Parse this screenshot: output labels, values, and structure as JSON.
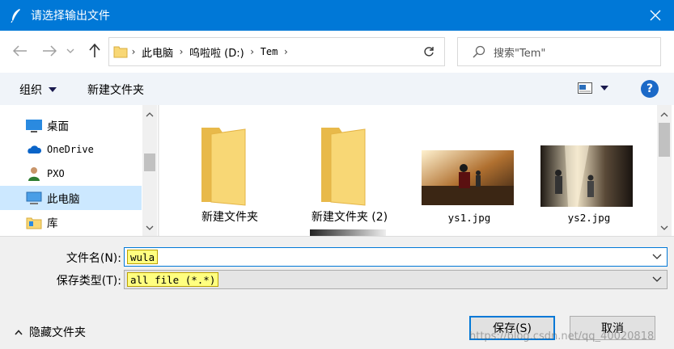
{
  "window": {
    "title": "请选择输出文件"
  },
  "address": {
    "crumbs": [
      "此电脑",
      "呜啦啦 (D:)",
      "Tem"
    ],
    "search_placeholder": "搜索\"Tem\""
  },
  "toolbar": {
    "organize": "组织",
    "new_folder": "新建文件夹"
  },
  "nav": {
    "items": [
      {
        "label": "桌面",
        "icon": "desktop-icon"
      },
      {
        "label": "OneDrive",
        "icon": "cloud-icon"
      },
      {
        "label": "PXO",
        "icon": "user-icon"
      },
      {
        "label": "此电脑",
        "icon": "computer-icon",
        "selected": true
      },
      {
        "label": "库",
        "icon": "library-icon"
      }
    ]
  },
  "files": [
    {
      "name": "新建文件夹",
      "type": "folder"
    },
    {
      "name": "新建文件夹 (2)",
      "type": "folder"
    },
    {
      "name": "ys1.jpg",
      "type": "image"
    },
    {
      "name": "ys2.jpg",
      "type": "image"
    }
  ],
  "form": {
    "filename_label": "文件名(N):",
    "filename_value": "wula",
    "filetype_label": "保存类型(T):",
    "filetype_value": "all file (*.*)"
  },
  "footer": {
    "hide_folders": "隐藏文件夹",
    "save": "保存(S)",
    "cancel": "取消",
    "watermark": "https://blog.csdn.net/qq_40020818"
  },
  "colors": {
    "accent": "#0078d7",
    "folder": "#f8d775",
    "selection": "#cce8ff",
    "highlight": "#ffff80"
  }
}
